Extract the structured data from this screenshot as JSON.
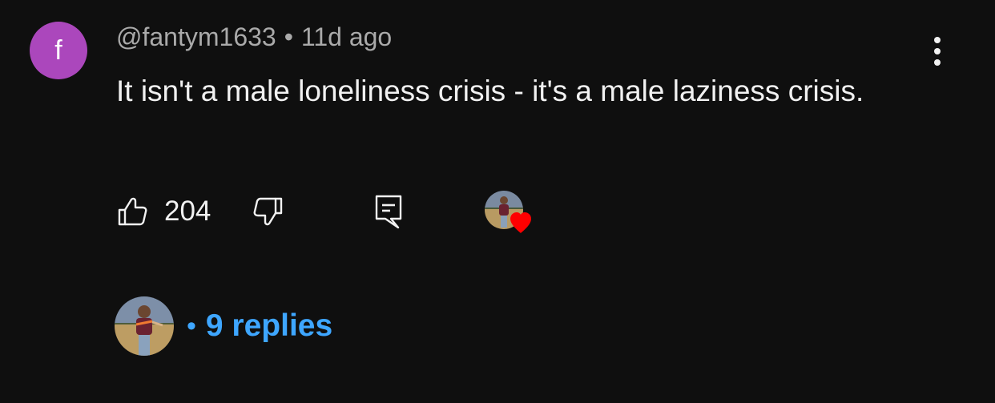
{
  "comment": {
    "avatar_letter": "f",
    "avatar_color": "#ab47bc",
    "author": "@fantym1633",
    "separator": "•",
    "timestamp": "11d ago",
    "text": "It isn't a male loneliness crisis - it's a male laziness crisis."
  },
  "actions": {
    "like_icon": "thumbs-up-icon",
    "like_count": "204",
    "dislike_icon": "thumbs-down-icon",
    "reply_icon": "comment-reply-icon",
    "creator_heart_icon": "heart-icon",
    "heart_color": "#ff0000"
  },
  "menu": {
    "icon": "more-vertical-icon"
  },
  "replies": {
    "separator": "•",
    "count_label": "9 replies",
    "link_color": "#3ea6ff"
  }
}
